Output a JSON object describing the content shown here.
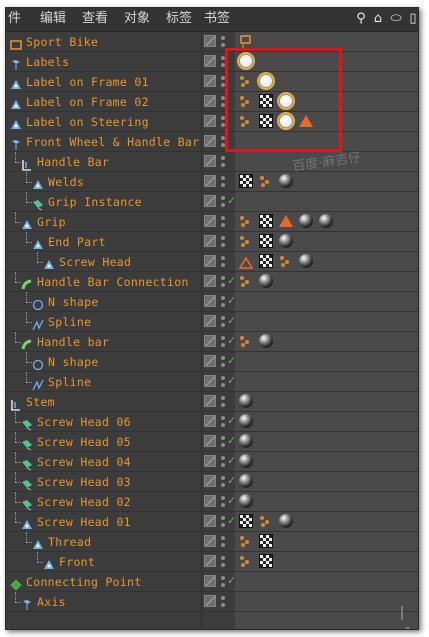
{
  "menu": {
    "items": [
      "件",
      "编辑",
      "查看",
      "对象",
      "标签",
      "书签"
    ]
  },
  "toolbar": {
    "icons": [
      "search-icon",
      "home-icon",
      "oval-icon",
      "panel-icon"
    ]
  },
  "tree": {
    "rows": [
      {
        "label": "Sport Bike",
        "icon": "layer-flag-icon",
        "indent": 0
      },
      {
        "label": "Labels",
        "icon": "null-icon",
        "indent": 0
      },
      {
        "label": "Label on Frame 01",
        "icon": "align-icon",
        "indent": 0
      },
      {
        "label": "Label on Frame 02",
        "icon": "align-icon",
        "indent": 0
      },
      {
        "label": "Label on Steering",
        "icon": "align-icon",
        "indent": 0
      },
      {
        "label": "Front Wheel & Handle Bar",
        "icon": "null-icon",
        "indent": 0
      },
      {
        "label": "Handle Bar",
        "icon": "lathe-icon",
        "indent": 1
      },
      {
        "label": "Welds",
        "icon": "align-icon",
        "indent": 2
      },
      {
        "label": "Grip Instance",
        "icon": "instance-icon",
        "indent": 2
      },
      {
        "label": "Grip",
        "icon": "align-icon",
        "indent": 1
      },
      {
        "label": "End Part",
        "icon": "align-icon",
        "indent": 2
      },
      {
        "label": "Screw Head",
        "icon": "align-icon",
        "indent": 3
      },
      {
        "label": "Handle Bar Connection",
        "icon": "sweep-icon",
        "indent": 1
      },
      {
        "label": "N shape",
        "icon": "circle-spline-icon",
        "indent": 2
      },
      {
        "label": "Spline",
        "icon": "spline-icon",
        "indent": 2
      },
      {
        "label": "Handle bar",
        "icon": "sweep-icon",
        "indent": 1
      },
      {
        "label": "N shape",
        "icon": "circle-spline-icon",
        "indent": 2
      },
      {
        "label": "Spline",
        "icon": "spline-icon",
        "indent": 2
      },
      {
        "label": "Stem",
        "icon": "lathe-icon",
        "indent": 0
      },
      {
        "label": "Screw Head 06",
        "icon": "instance-icon",
        "indent": 1
      },
      {
        "label": "Screw Head 05",
        "icon": "instance-icon",
        "indent": 1
      },
      {
        "label": "Screw Head 04",
        "icon": "instance-icon",
        "indent": 1
      },
      {
        "label": "Screw Head 03",
        "icon": "instance-icon",
        "indent": 1
      },
      {
        "label": "Screw Head 02",
        "icon": "instance-icon",
        "indent": 1
      },
      {
        "label": "Screw Head 01",
        "icon": "align-icon",
        "indent": 1
      },
      {
        "label": "Thread",
        "icon": "align-icon",
        "indent": 2
      },
      {
        "label": "Front",
        "icon": "align-icon",
        "indent": 3
      },
      {
        "label": "Connecting Point",
        "icon": "connect-icon",
        "indent": 0
      },
      {
        "label": "Axis",
        "icon": "null-icon",
        "indent": 1
      }
    ]
  },
  "tags": {
    "rows": [
      [
        "layer-tag-icon"
      ],
      [
        "white-material-tag-icon"
      ],
      [
        "phong-tag-icon",
        "white-material-tag-icon"
      ],
      [
        "phong-tag-icon",
        "checker-tag-icon",
        "white-material-tag-icon"
      ],
      [
        "phong-tag-icon",
        "checker-tag-icon",
        "white-material-tag-icon",
        "triangle-tag-icon"
      ],
      [],
      [],
      [
        "checker-tag-icon",
        "phong-tag-icon",
        "sphere-tag-icon"
      ],
      [],
      [
        "phong-tag-icon",
        "checker-tag-icon",
        "triangle-tag-icon",
        "sphere-tag-icon",
        "sphere-tag-icon"
      ],
      [
        "phong-tag-icon",
        "checker-tag-icon",
        "sphere-tag-icon"
      ],
      [
        "triangle-outline-tag-icon",
        "checker-tag-icon",
        "phong-tag-icon",
        "sphere-tag-icon"
      ],
      [
        "phong-tag-icon",
        "sphere-tag-icon"
      ],
      [],
      [],
      [
        "phong-tag-icon",
        "sphere-tag-icon"
      ],
      [],
      [],
      [
        "sphere-tag-icon"
      ],
      [
        "sphere-tag-icon"
      ],
      [
        "sphere-tag-icon"
      ],
      [
        "sphere-tag-icon"
      ],
      [
        "sphere-tag-icon"
      ],
      [
        "sphere-tag-icon"
      ],
      [
        "checker-tag-icon",
        "phong-tag-icon",
        "sphere-tag-icon"
      ],
      [
        "phong-tag-icon",
        "checker-tag-icon"
      ],
      [
        "phong-tag-icon",
        "checker-tag-icon"
      ],
      [],
      []
    ],
    "highlighted_rows": [
      1,
      2,
      3,
      4
    ]
  },
  "flags": {
    "checked_rows": [
      8,
      12,
      13,
      14,
      15,
      16,
      17,
      19,
      20,
      21,
      22,
      23,
      24,
      27
    ]
  },
  "colors": {
    "label": "#e8962f",
    "checkmark": "#4ec34a",
    "highlight_box": "#e0141a"
  },
  "watermark": "百度·麻吉仔",
  "status": {
    "corner_number": "0"
  }
}
